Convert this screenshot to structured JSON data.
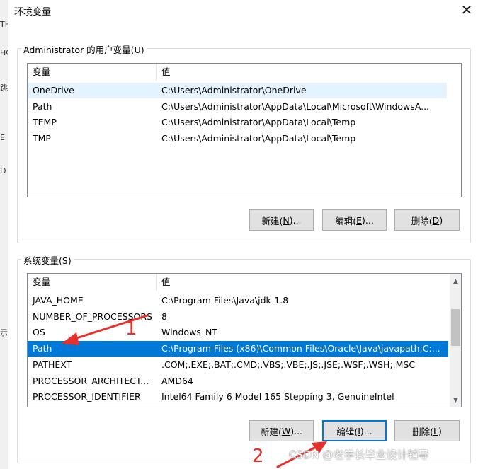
{
  "window": {
    "title": "环境变量",
    "close_glyph": "✕"
  },
  "background_fragments": [
    "TH",
    "HC",
    "跳",
    "E",
    "D",
    "示"
  ],
  "user_vars": {
    "label_prefix": "Administrator 的用户变量(",
    "label_key": "U",
    "label_suffix": ")",
    "columns": [
      "变量",
      "值"
    ],
    "rows": [
      {
        "name": "OneDrive",
        "value": "C:\\Users\\Administrator\\OneDrive",
        "state": "hover"
      },
      {
        "name": "Path",
        "value": "C:\\Users\\Administrator\\AppData\\Local\\Microsoft\\WindowsA...",
        "state": ""
      },
      {
        "name": "TEMP",
        "value": "C:\\Users\\Administrator\\AppData\\Local\\Temp",
        "state": ""
      },
      {
        "name": "TMP",
        "value": "C:\\Users\\Administrator\\AppData\\Local\\Temp",
        "state": ""
      }
    ],
    "buttons": [
      {
        "pre": "新建(",
        "key": "N",
        "post": ")..."
      },
      {
        "pre": "编辑(",
        "key": "E",
        "post": ")..."
      },
      {
        "pre": "删除(",
        "key": "D",
        "post": ")"
      }
    ]
  },
  "system_vars": {
    "label_prefix": "系统变量(",
    "label_key": "S",
    "label_suffix": ")",
    "columns": [
      "变量",
      "值"
    ],
    "rows": [
      {
        "name": "JAVA_HOME",
        "value": "C:\\Program Files\\Java\\jdk-1.8",
        "state": ""
      },
      {
        "name": "NUMBER_OF_PROCESSORS",
        "value": "8",
        "state": ""
      },
      {
        "name": "OS",
        "value": "Windows_NT",
        "state": ""
      },
      {
        "name": "Path",
        "value": "C:\\Program Files (x86)\\Common Files\\Oracle\\Java\\javapath;C:...",
        "state": "selected"
      },
      {
        "name": "PATHEXT",
        "value": ".COM;.EXE;.BAT;.CMD;.VBS;.VBE;.JS;.JSE;.WSF;.WSH;.MSC",
        "state": ""
      },
      {
        "name": "PROCESSOR_ARCHITECT...",
        "value": "AMD64",
        "state": ""
      },
      {
        "name": "PROCESSOR_IDENTIFIER",
        "value": "Intel64 Family 6 Model 165 Stepping 3, GenuineIntel",
        "state": ""
      }
    ],
    "buttons": [
      {
        "pre": "新建(",
        "key": "W",
        "post": ")..."
      },
      {
        "pre": "编辑(",
        "key": "I",
        "post": ")..."
      },
      {
        "pre": "删除(",
        "key": "L",
        "post": ")"
      }
    ],
    "scroll_up_glyph": "▲",
    "scroll_down_glyph": "▼"
  },
  "annotations": {
    "step1": "1",
    "step2": "2",
    "arrow_color": "#e8302a"
  },
  "watermark": "CSDN @老学长毕业设计辅导"
}
